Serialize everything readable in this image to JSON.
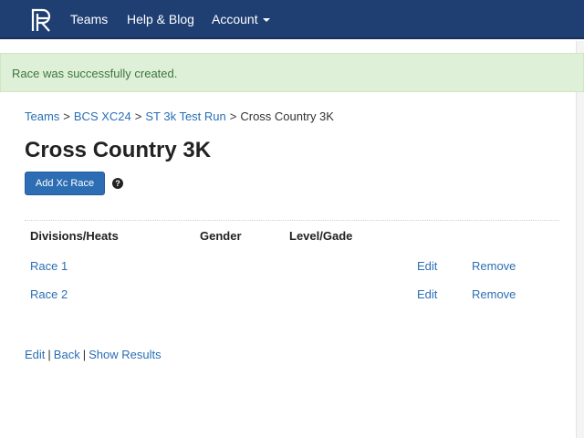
{
  "navbar": {
    "logo_icon": "rp-logo-icon",
    "items": [
      {
        "label": "Teams"
      },
      {
        "label": "Help & Blog"
      },
      {
        "label": "Account"
      }
    ],
    "background": "#1f3f73"
  },
  "alert": {
    "message": "Race was successfully created.",
    "background": "#dff0d8",
    "color": "#3c763d"
  },
  "breadcrumb": {
    "items": [
      "Teams",
      "BCS XC24",
      "ST 3k Test Run"
    ],
    "current": "Cross Country 3K",
    "separator": ">"
  },
  "page": {
    "title": "Cross Country 3K",
    "add_button": "Add Xc Race",
    "help_icon": "question-circle-icon"
  },
  "table": {
    "headers": [
      "Divisions/Heats",
      "Gender",
      "Level/Gade"
    ],
    "rows": [
      {
        "name": "Race 1",
        "edit": "Edit",
        "remove": "Remove"
      },
      {
        "name": "Race 2",
        "edit": "Edit",
        "remove": "Remove"
      }
    ]
  },
  "footer": {
    "edit": "Edit",
    "back": "Back",
    "show_results": "Show Results",
    "separator": "|"
  },
  "colors": {
    "link": "#2a6fb5",
    "primary_button": "#2c6db3"
  }
}
